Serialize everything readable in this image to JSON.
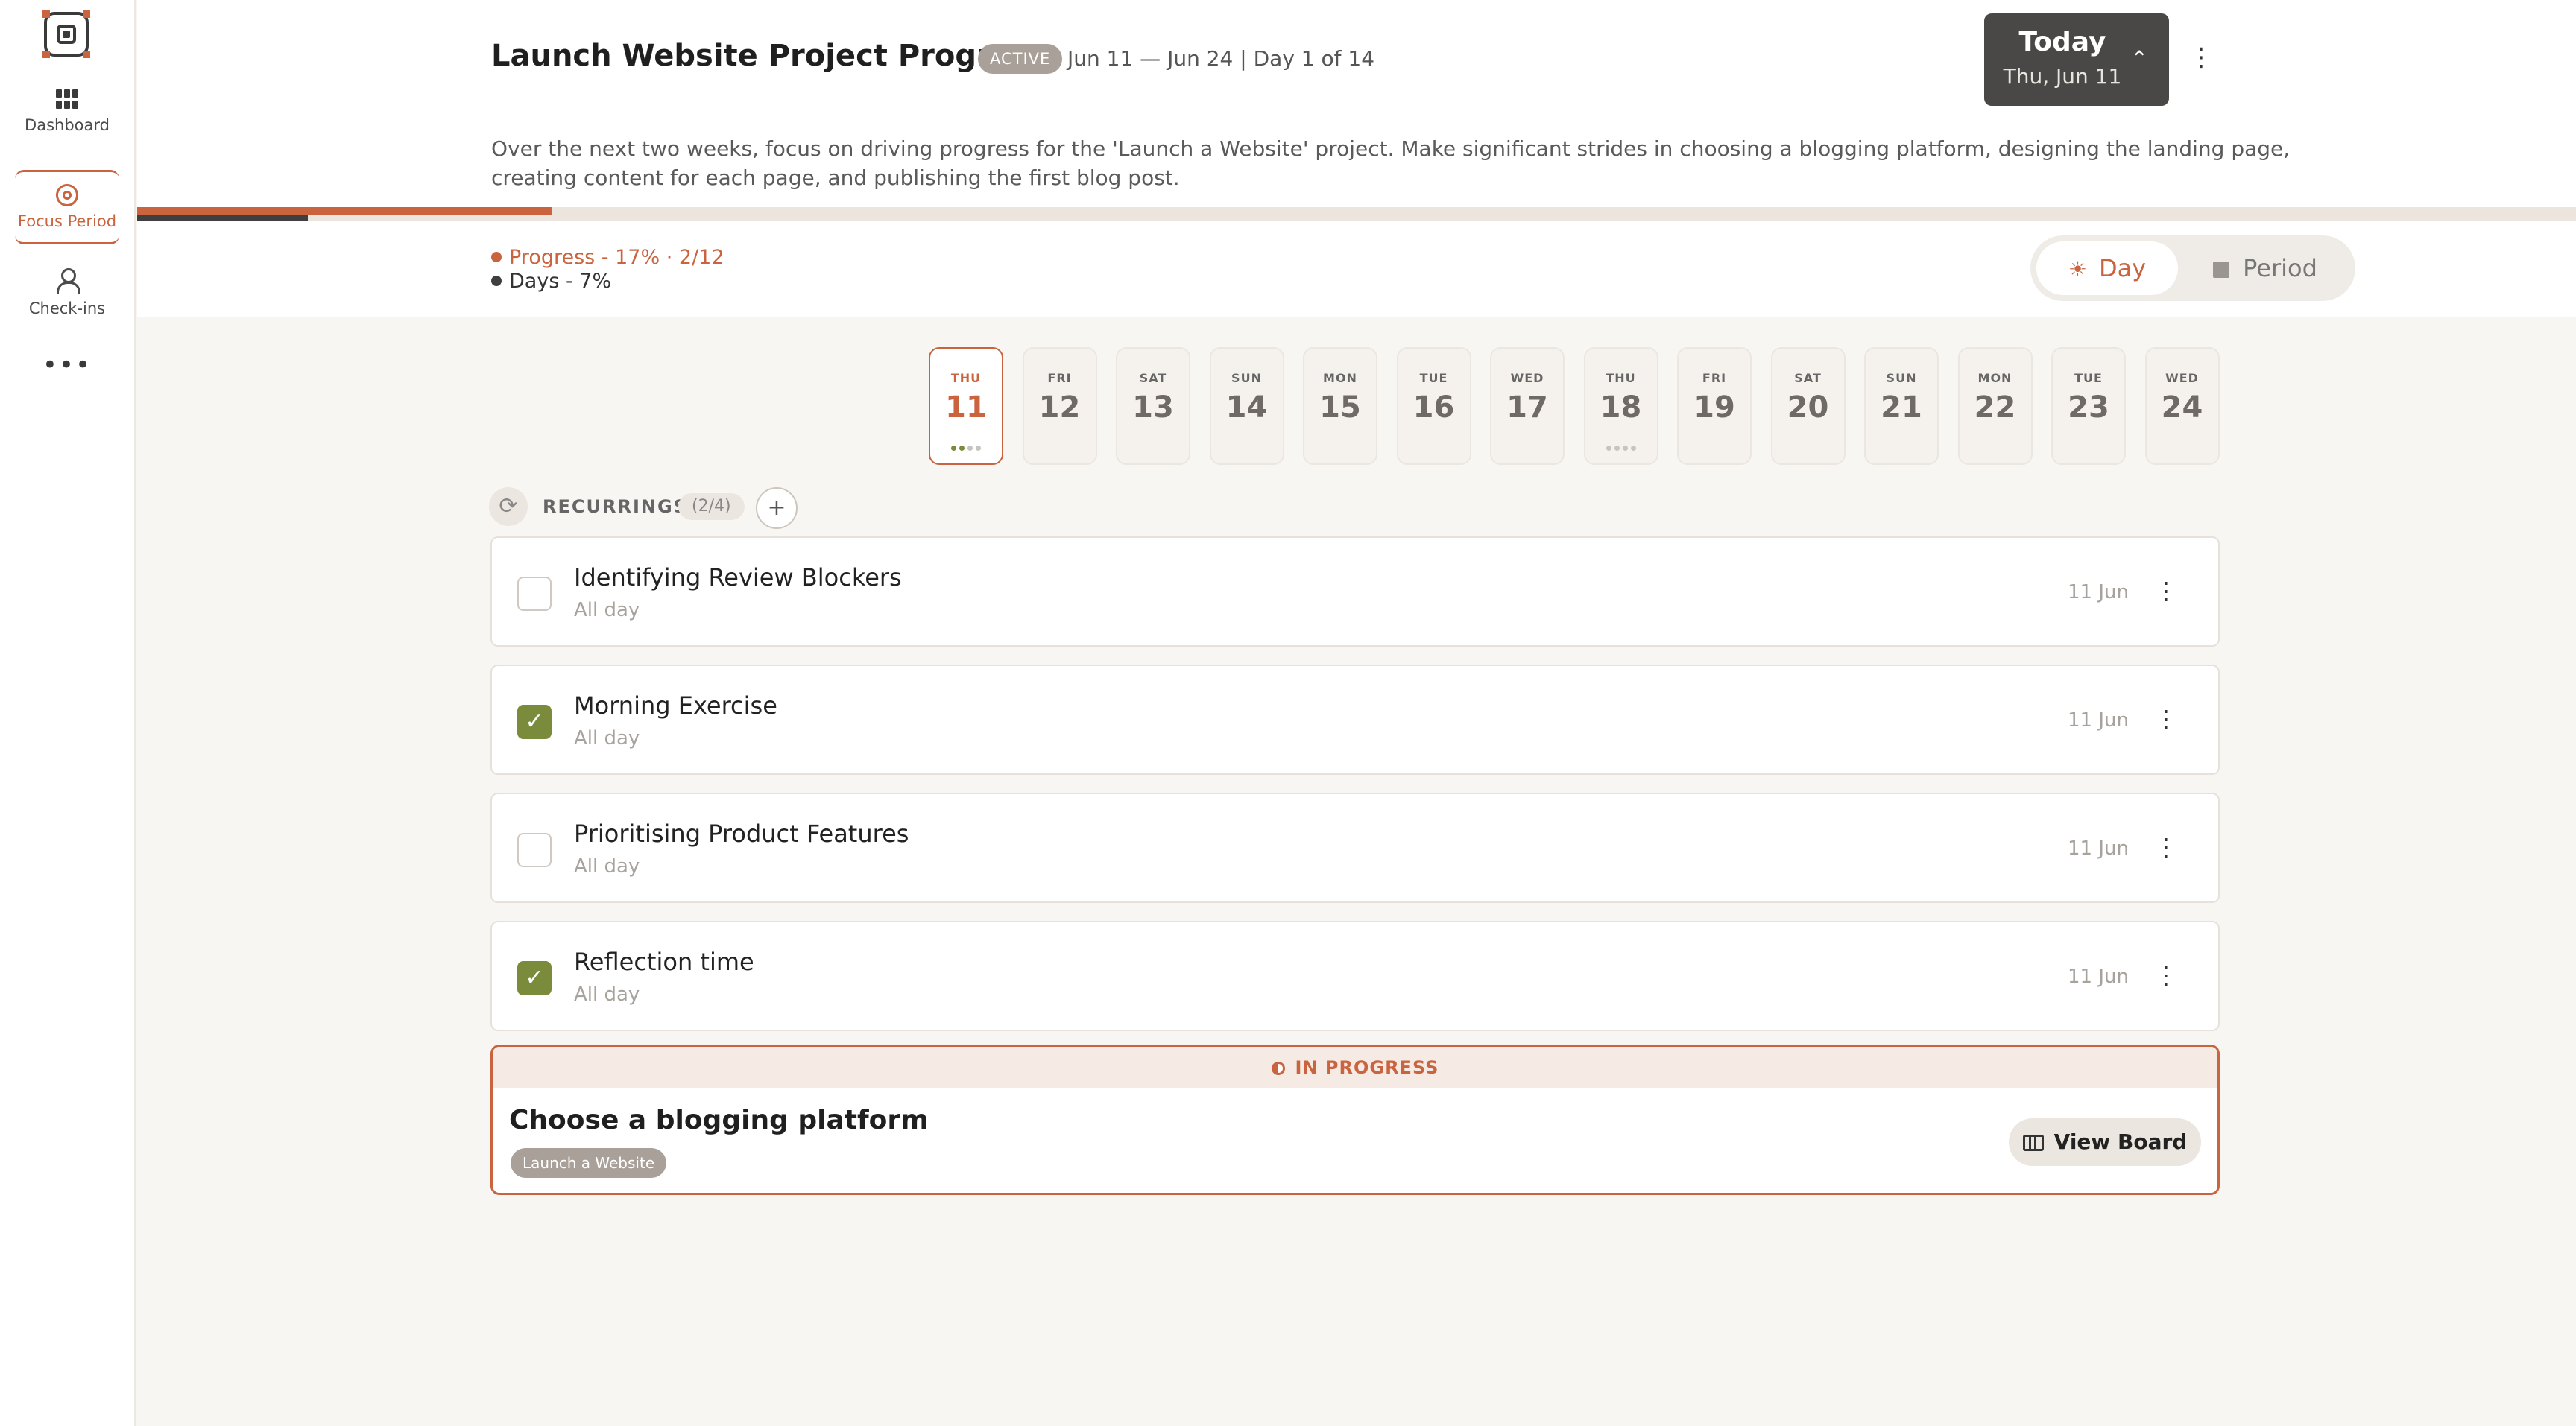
{
  "sidebar": {
    "items": [
      {
        "label": "Dashboard",
        "icon": "grid-icon"
      },
      {
        "label": "Focus Period",
        "icon": "target-icon",
        "active": true
      },
      {
        "label": "Check-ins",
        "icon": "person-icon"
      },
      {
        "label": "•••",
        "icon": "more-icon"
      }
    ]
  },
  "header": {
    "title": "Launch Website Project Progress",
    "status_badge": "ACTIVE",
    "date_range": "Jun 11 — Jun 24 | Day 1 of 14",
    "today_button": {
      "label": "Today",
      "date": "Thu, Jun 11"
    },
    "description": "Over the next two weeks, focus on driving progress for the 'Launch a Website' project. Make significant strides in choosing a blogging platform, designing the landing page, creating content for each page, and publishing the first blog post."
  },
  "progress": {
    "progress_label": "Progress - 17% · 2/12",
    "days_label": "Days - 7%",
    "progress_fraction": 0.17,
    "days_fraction": 0.07
  },
  "view_toggle": {
    "day": "Day",
    "period": "Period",
    "selected": "Day"
  },
  "days": [
    {
      "dow": "THU",
      "date": "11",
      "active": true,
      "dots": [
        "g",
        "g",
        "n",
        "n"
      ]
    },
    {
      "dow": "FRI",
      "date": "12"
    },
    {
      "dow": "SAT",
      "date": "13"
    },
    {
      "dow": "SUN",
      "date": "14"
    },
    {
      "dow": "MON",
      "date": "15"
    },
    {
      "dow": "TUE",
      "date": "16"
    },
    {
      "dow": "WED",
      "date": "17"
    },
    {
      "dow": "THU",
      "date": "18",
      "dots": [
        "n",
        "n",
        "n",
        "n"
      ]
    },
    {
      "dow": "FRI",
      "date": "19"
    },
    {
      "dow": "SAT",
      "date": "20"
    },
    {
      "dow": "SUN",
      "date": "21"
    },
    {
      "dow": "MON",
      "date": "22"
    },
    {
      "dow": "TUE",
      "date": "23"
    },
    {
      "dow": "WED",
      "date": "24"
    }
  ],
  "recurrings": {
    "label": "RECURRINGS",
    "count": "(2/4)",
    "add": "+",
    "tasks": [
      {
        "name": "Identifying Review Blockers",
        "sub": "All day",
        "date": "11 Jun",
        "done": false
      },
      {
        "name": "Morning Exercise",
        "sub": "All day",
        "date": "11 Jun",
        "done": true
      },
      {
        "name": "Prioritising Product Features",
        "sub": "All day",
        "date": "11 Jun",
        "done": false
      },
      {
        "name": "Reflection time",
        "sub": "All day",
        "date": "11 Jun",
        "done": true
      }
    ]
  },
  "in_progress": {
    "status": "IN PROGRESS",
    "title": "Choose a blogging platform",
    "tag": "Launch a Website",
    "button": "View Board"
  },
  "colors": {
    "accent": "#c9643f",
    "done_green": "#7a8c3b",
    "dark": "#4a4846"
  }
}
